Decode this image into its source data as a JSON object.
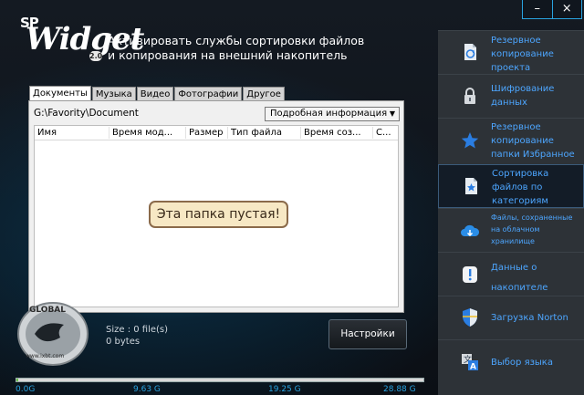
{
  "window": {
    "minimize_label": "–",
    "close_label": "×"
  },
  "app": {
    "logo_sp": "SP",
    "logo_widget": "Widget",
    "logo_version": "2.0",
    "title": "Активировать службы сортировки файлов и копирования на внешний накопитель"
  },
  "tabs": [
    "Документы",
    "Музыка",
    "Видео",
    "Фотографии",
    "Другое"
  ],
  "path": "G:\\Favority\\Document",
  "view_select": "Подробная информация",
  "columns": [
    "Имя",
    "Время мод...",
    "Размер",
    "Тип файла",
    "Время соз...",
    "С..."
  ],
  "empty_message": "Эта папка пустая!",
  "size_info": {
    "line1": "Size : 0 file(s)",
    "line2": "0 bytes"
  },
  "settings_button": "Настройки",
  "badge": {
    "top": "GLOBAL",
    "bottom": "www.ixbt.com"
  },
  "storage": {
    "used_fraction": 0.005,
    "labels": [
      "0.0G",
      "9.63 G",
      "19.25 G",
      "28.88 G"
    ]
  },
  "sidebar": [
    {
      "label": "Резервное копирование проекта",
      "icon": "backup-project-icon"
    },
    {
      "label": "Шифрование данных",
      "icon": "lock-icon"
    },
    {
      "label": "Резервное копирование папки Избранное",
      "icon": "star-icon"
    },
    {
      "label": "Сортировка файлов по категориям",
      "icon": "sort-files-icon"
    },
    {
      "label": "Файлы, сохраненные на облачном хранилище",
      "icon": "cloud-icon"
    },
    {
      "label": "Данные о накопителе",
      "icon": "info-icon"
    },
    {
      "label": "Загрузка Norton",
      "icon": "norton-shield-icon"
    },
    {
      "label": "Выбор языка",
      "icon": "language-icon"
    }
  ],
  "colors": {
    "accent": "#4da6ff",
    "sidebar_bg": "#2d3237",
    "scale": "#29a3e0"
  }
}
